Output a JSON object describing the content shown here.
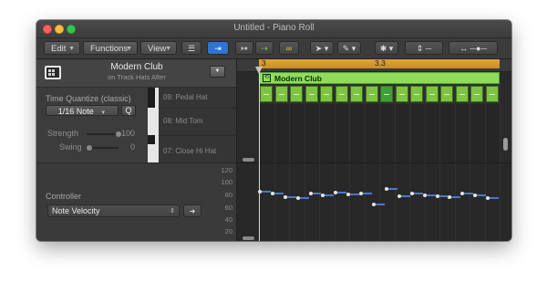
{
  "window": {
    "title": "Untitled - Piano Roll"
  },
  "toolbar": {
    "edit_label": "Edit",
    "functions_label": "Functions",
    "view_label": "View"
  },
  "region": {
    "name": "Modern Club",
    "subtitle": "on Track Hats After"
  },
  "quantize": {
    "label": "Time Quantize (classic)",
    "value": "1/16 Note",
    "q_button": "Q",
    "strength_label": "Strength",
    "strength_value": "100",
    "strength_level": 1.0,
    "swing_label": "Swing",
    "swing_value": "0",
    "swing_level": 0.0
  },
  "keys": [
    {
      "label": "09: Pedal Hat",
      "color": "white"
    },
    {
      "label": "08: Mid Tom",
      "color": "black"
    },
    {
      "label": "07: Close Hi Hat",
      "color": "white"
    }
  ],
  "controller": {
    "label": "Controller",
    "selected": "Note Velocity",
    "scale": [
      "120",
      "100",
      "80",
      "60",
      "40",
      "20"
    ]
  },
  "ruler": {
    "marks": [
      "3",
      "3.3"
    ]
  },
  "velocities": [
    95,
    90,
    84,
    82,
    91,
    88,
    92,
    89,
    91,
    70,
    100,
    85,
    90,
    88,
    86,
    84,
    90,
    87,
    82
  ]
}
